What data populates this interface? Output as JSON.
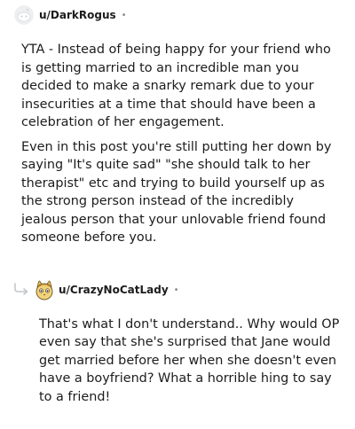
{
  "comments": [
    {
      "author": "u/DarkRogus",
      "avatar_icon": "snoo-avatar-icon",
      "separator": "•",
      "paragraphs": [
        "YTA - Instead of being happy for your friend who is getting married to an incredible man you decided to make a snarky remark due to your insecurities at a time that should have been a celebration of her engagement.",
        "Even in this post you're still putting her down by saying \"It's quite sad\" \"she should talk to her therapist\" etc and trying to build yourself up as the strong person instead of the incredibly jealous person that your unlovable friend found someone before you."
      ]
    },
    {
      "author": "u/CrazyNoCatLady",
      "avatar_icon": "cat-avatar-icon",
      "separator": "•",
      "is_reply": true,
      "paragraphs": [
        "That's what I don't understand.. Why would OP even say that she's surprised that Jane would get married before her when she doesn't even have a boyfriend? What a horrible hing to say to a friend!"
      ]
    }
  ]
}
